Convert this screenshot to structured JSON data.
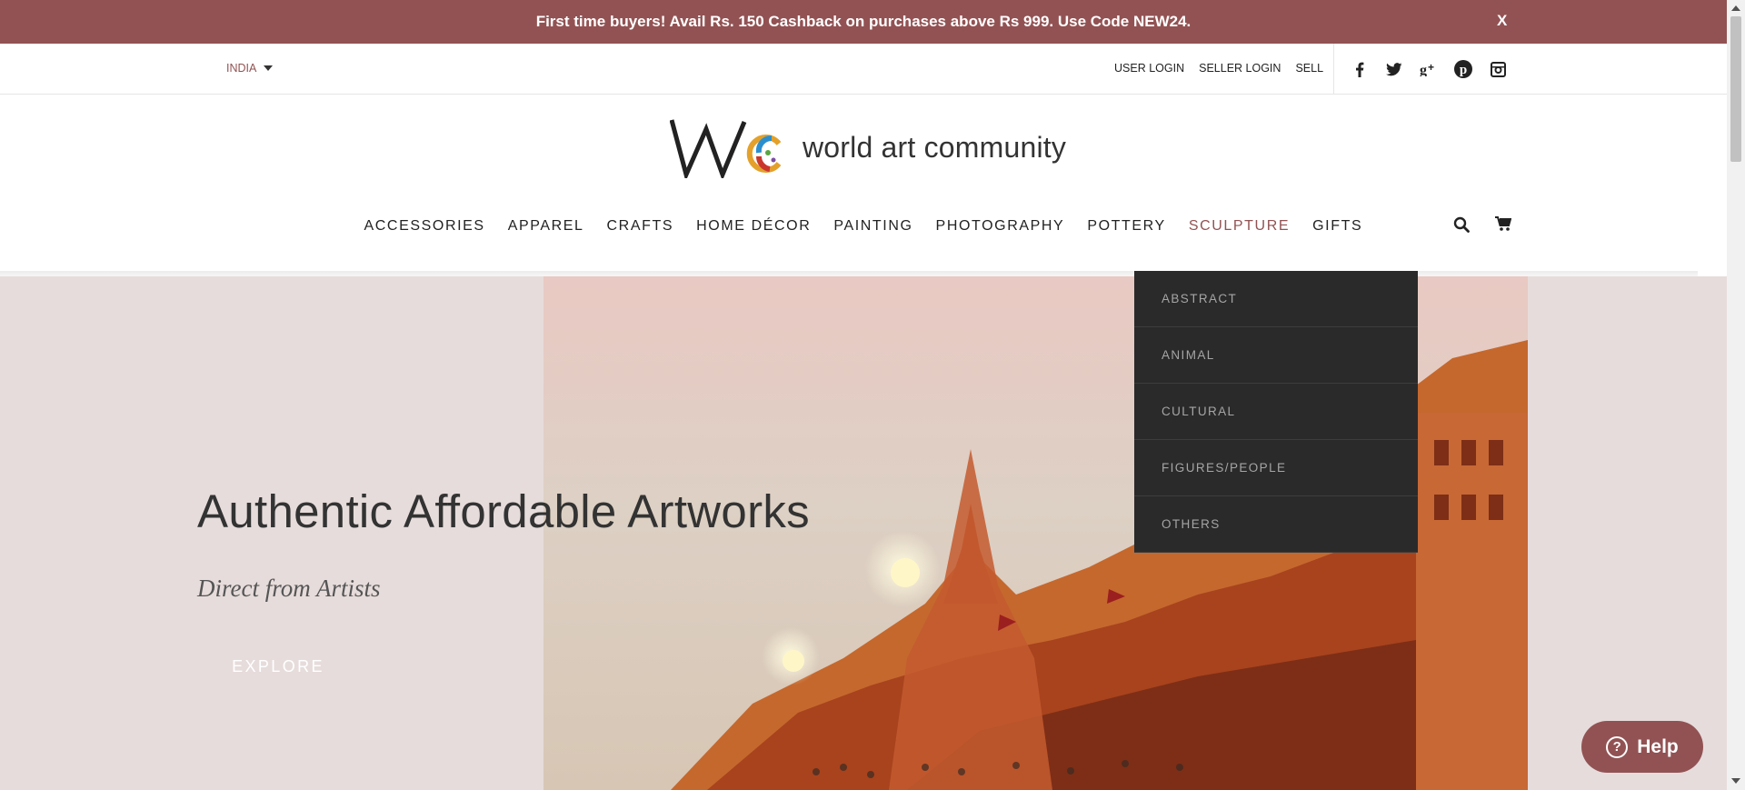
{
  "promo": {
    "text": "First time buyers! Avail Rs. 150 Cashback on purchases above Rs 999. Use Code NEW24.",
    "close_label": "X"
  },
  "utility": {
    "country": "INDIA",
    "links": [
      "USER LOGIN",
      "SELLER LOGIN",
      "SELL"
    ],
    "socials": [
      "facebook-icon",
      "twitter-icon",
      "google-plus-icon",
      "pinterest-icon",
      "instagram-icon"
    ]
  },
  "logo": {
    "text": "world art community"
  },
  "nav": {
    "items": [
      "ACCESSORIES",
      "APPAREL",
      "CRAFTS",
      "HOME DÉCOR",
      "PAINTING",
      "PHOTOGRAPHY",
      "POTTERY",
      "SCULPTURE",
      "GIFTS"
    ],
    "active": "SCULPTURE"
  },
  "dropdown": {
    "items": [
      "ABSTRACT",
      "ANIMAL",
      "CULTURAL",
      "FIGURES/PEOPLE",
      "OTHERS"
    ]
  },
  "hero": {
    "title": "Authentic Affordable Artworks",
    "subtitle": "Direct from Artists",
    "button": "EXPLORE"
  },
  "help": {
    "label": "Help"
  },
  "colors": {
    "brand": "#925253",
    "dropdown_bg": "#2a2a2a"
  }
}
